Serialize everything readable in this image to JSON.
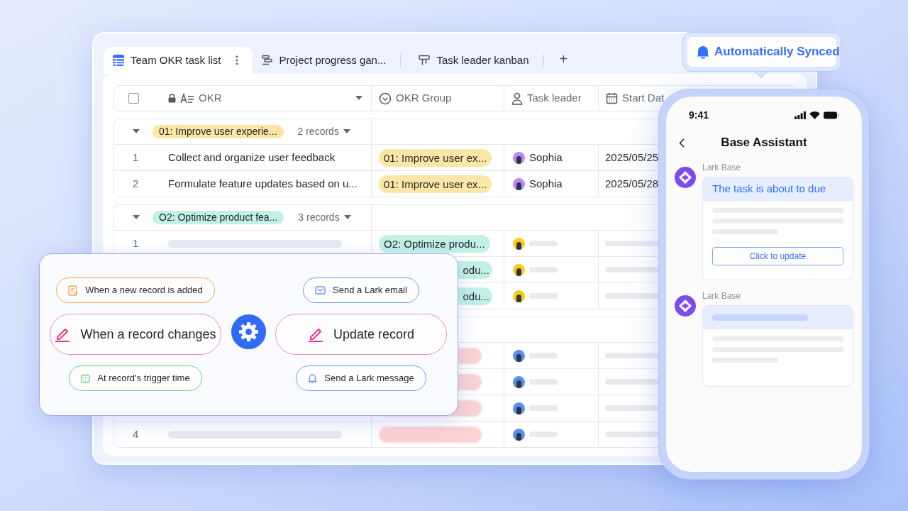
{
  "tabs": [
    {
      "label": "Team OKR task list",
      "kind": "grid",
      "selected": true
    },
    {
      "label": "Project progress gan...",
      "kind": "gantt",
      "selected": false
    },
    {
      "label": "Task leader kanban",
      "kind": "kanban",
      "selected": false
    }
  ],
  "add_tab": "+",
  "table": {
    "select_all": {
      "checked": false
    },
    "columns": [
      {
        "label": "OKR",
        "kind": "text"
      },
      {
        "label": "OKR Group",
        "kind": "select"
      },
      {
        "label": "Task leader",
        "kind": "person"
      },
      {
        "label": "Start Dat",
        "kind": "date"
      }
    ],
    "groups": [
      {
        "label": "01: Improve user experie...",
        "count": "2 records",
        "color": "#fbe6a6",
        "rows": [
          {
            "index": "1",
            "okr": "Collect and organize user feedback",
            "group": "01: Improve user ex...",
            "leader": {
              "name": "Sophia",
              "color": "#c084fc"
            },
            "start": "2025/05/25"
          },
          {
            "index": "2",
            "okr": "Formulate feature updates based on u...",
            "group": "01: Improve user ex...",
            "leader": {
              "name": "Sophia",
              "color": "#c084fc"
            },
            "start": "2025/05/28"
          }
        ]
      },
      {
        "label": "O2: Optimize product fea...",
        "count": "3 records",
        "color": "#c3f0e6",
        "rows": [
          {
            "index": "1",
            "group": "O2: Optimize produ...",
            "leader": {
              "color": "#facc15"
            }
          },
          {
            "group": "odu...",
            "leader": {
              "color": "#facc15"
            }
          },
          {
            "group": "odu...",
            "leader": {
              "color": "#facc15"
            }
          }
        ]
      },
      {
        "color": "#fcd3d3",
        "rows": [
          {
            "leader": {
              "color": "#5b8def"
            }
          },
          {
            "leader": {
              "color": "#5b8def"
            }
          },
          {
            "leader": {
              "color": "#5b8def"
            }
          },
          {
            "index": "4",
            "leader": {
              "color": "#5b8def"
            }
          }
        ]
      }
    ]
  },
  "automation": {
    "triggers": [
      {
        "label": "When a new record is added",
        "kind": "new",
        "color": "#f5a04a",
        "highlighted": false
      },
      {
        "label": "When a record changes",
        "kind": "edit",
        "color": "#f38bbd",
        "highlighted": true
      },
      {
        "label": "At record's trigger time",
        "kind": "time",
        "color": "#5fd37a",
        "highlighted": false
      }
    ],
    "actions": [
      {
        "label": "Send a Lark email",
        "kind": "mail",
        "color": "#6f94f7",
        "highlighted": false
      },
      {
        "label": "Update record",
        "kind": "edit",
        "color": "#f38bbd",
        "highlighted": true
      },
      {
        "label": "Send a Lark message",
        "kind": "bell",
        "color": "#6f94f7",
        "highlighted": false
      }
    ]
  },
  "sync_banner": "Automatically Synced",
  "phone": {
    "time": "9:41",
    "title": "Base Assistant",
    "messages": [
      {
        "sender": "Lark Base",
        "title": "The task is about to due",
        "button": "Click to update"
      },
      {
        "sender": "Lark Base"
      }
    ]
  }
}
